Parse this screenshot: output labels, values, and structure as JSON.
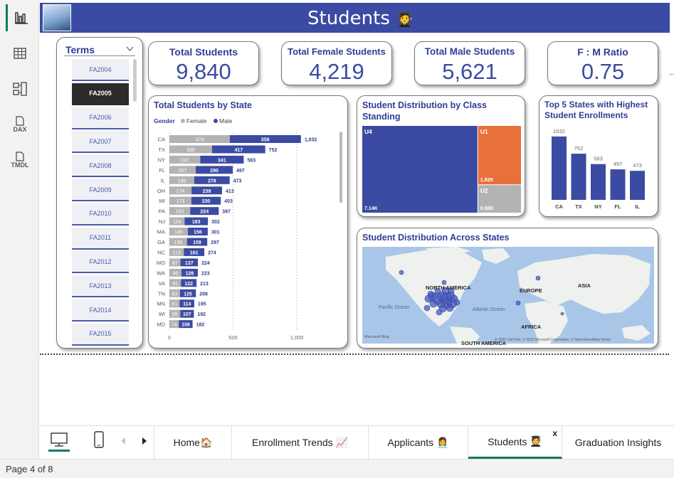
{
  "report": {
    "title": "Students",
    "title_emoji": "🧑‍🎓"
  },
  "left_rail": {
    "items": [
      {
        "name": "report-view-icon",
        "label": ""
      },
      {
        "name": "table-view-icon",
        "label": ""
      },
      {
        "name": "model-view-icon",
        "label": ""
      },
      {
        "name": "dax-query-view-icon",
        "label": "DAX"
      },
      {
        "name": "tmdl-view-icon",
        "label": "TMDL"
      }
    ]
  },
  "kpis": [
    {
      "title": "Total Students",
      "value": "9,840"
    },
    {
      "title": "Total Female Students",
      "value": "4,219"
    },
    {
      "title": "Total Male Students",
      "value": "5,621"
    },
    {
      "title": "F : M Ratio",
      "value": "0.75"
    }
  ],
  "terms_slicer": {
    "title": "Terms",
    "selected": "FA2005",
    "items": [
      "FA2004",
      "FA2005",
      "FA2006",
      "FA2007",
      "FA2008",
      "FA2009",
      "FA2010",
      "FA2011",
      "FA2012",
      "FA2013",
      "FA2014",
      "FA2015"
    ]
  },
  "state_chart": {
    "title": "Total Students by State",
    "legend_title": "Gender",
    "legend": [
      {
        "name": "Female",
        "color": "#b3b3b3"
      },
      {
        "name": "Male",
        "color": "#3b4ba3"
      }
    ],
    "x_ticks": [
      "0",
      "500",
      "1,000"
    ],
    "chart_data": {
      "type": "bar",
      "orientation": "horizontal-stacked",
      "categories": [
        "CA",
        "TX",
        "NY",
        "FL",
        "IL",
        "OH",
        "MI",
        "PA",
        "NJ",
        "MA",
        "GA",
        "NC",
        "MO",
        "WA",
        "VA",
        "TN",
        "MN",
        "WI",
        "MD"
      ],
      "series": [
        {
          "name": "Female",
          "values": [
            474,
            335,
            242,
            207,
            195,
            174,
            173,
            163,
            119,
            145,
            138,
            113,
            87,
            95,
            91,
            83,
            81,
            85,
            74
          ]
        },
        {
          "name": "Male",
          "values": [
            558,
            417,
            341,
            290,
            278,
            239,
            230,
            224,
            183,
            156,
            159,
            161,
            137,
            128,
            122,
            125,
            114,
            107,
            108
          ]
        }
      ],
      "totals": [
        1032,
        752,
        583,
        497,
        473,
        413,
        403,
        387,
        302,
        301,
        297,
        274,
        224,
        223,
        213,
        208,
        195,
        192,
        182
      ],
      "total_labels": [
        "1,032",
        "752",
        "583",
        "497",
        "473",
        "413",
        "403",
        "387",
        "302",
        "301",
        "297",
        "274",
        "224",
        "223",
        "213",
        "208",
        "195",
        "192",
        "182"
      ],
      "xlim": [
        0,
        1100
      ]
    }
  },
  "class_chart": {
    "title": "Student Distribution by Class Standing",
    "chart_data": {
      "type": "treemap",
      "items": [
        {
          "name": "U4",
          "label": "7.14K",
          "value": 7140,
          "color": "#3b4ba3"
        },
        {
          "name": "U1",
          "label": "1.82K",
          "value": 1820,
          "color": "#e8703a"
        },
        {
          "name": "U2",
          "label": "0.88K",
          "value": 880,
          "color": "#b3b3b3"
        }
      ]
    }
  },
  "top5_chart": {
    "title": "Top 5 States with Highest Student Enrollments",
    "chart_data": {
      "type": "bar",
      "categories": [
        "CA",
        "TX",
        "NY",
        "FL",
        "IL"
      ],
      "values": [
        1032,
        752,
        583,
        497,
        473
      ],
      "ylim": [
        0,
        1100
      ]
    }
  },
  "map": {
    "title": "Student Distribution Across States",
    "labels": {
      "north_america": "NORTH AMERICA",
      "europe": "EUROPE",
      "asia": "ASIA",
      "africa": "AFRICA",
      "south_america": "SOUTH AMERICA",
      "pacific": "Pacific Ocean",
      "atlantic": "Atlantic Ocean"
    },
    "attribution": "© 2025 TomTom, © 2025 Microsoft Corporation, © OpenStreetMap Terms",
    "brand": "Microsoft Bing"
  },
  "tabs": [
    {
      "label": "Home",
      "emoji": "🏠"
    },
    {
      "label": "Enrollment Trends",
      "emoji": "📈"
    },
    {
      "label": "Applicants",
      "emoji": "👩‍💼"
    },
    {
      "label": "Students",
      "emoji": "🧑‍🎓"
    },
    {
      "label": "Graduation Insights",
      "emoji": ""
    }
  ],
  "active_tab": "Students",
  "tab_close": "x",
  "status": {
    "page": "Page 4 of 8"
  },
  "colors": {
    "header": "#3b4ba3",
    "male": "#3b4ba3",
    "female": "#b3b3b3",
    "u1": "#e8703a",
    "accent": "#117865"
  }
}
